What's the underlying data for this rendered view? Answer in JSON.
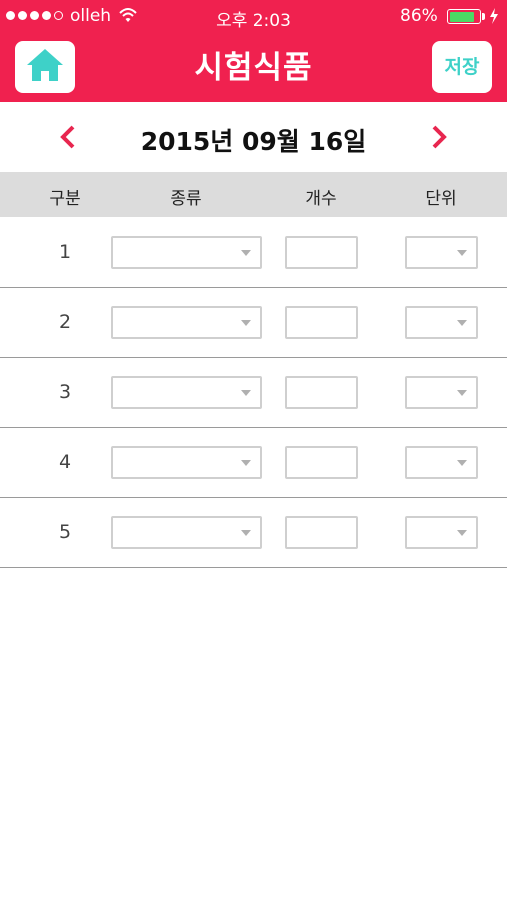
{
  "status_bar": {
    "carrier": "olleh",
    "time": "오후 2:03",
    "battery_percent": "86%",
    "battery_level": 0.86,
    "signal_bars": 4
  },
  "header": {
    "title": "시험식품",
    "home_icon": "home-icon",
    "save_label": "저장",
    "accent_color": "#f0214f",
    "button_color": "#3ed1c8"
  },
  "date_nav": {
    "date": "2015년 09월 16일",
    "prev_icon": "chevron-left-icon",
    "next_icon": "chevron-right-icon"
  },
  "table": {
    "columns": [
      "구분",
      "종류",
      "개수",
      "단위"
    ],
    "rows": [
      {
        "index": "1",
        "type": "",
        "count": "",
        "unit": ""
      },
      {
        "index": "2",
        "type": "",
        "count": "",
        "unit": ""
      },
      {
        "index": "3",
        "type": "",
        "count": "",
        "unit": ""
      },
      {
        "index": "4",
        "type": "",
        "count": "",
        "unit": ""
      },
      {
        "index": "5",
        "type": "",
        "count": "",
        "unit": ""
      }
    ]
  }
}
